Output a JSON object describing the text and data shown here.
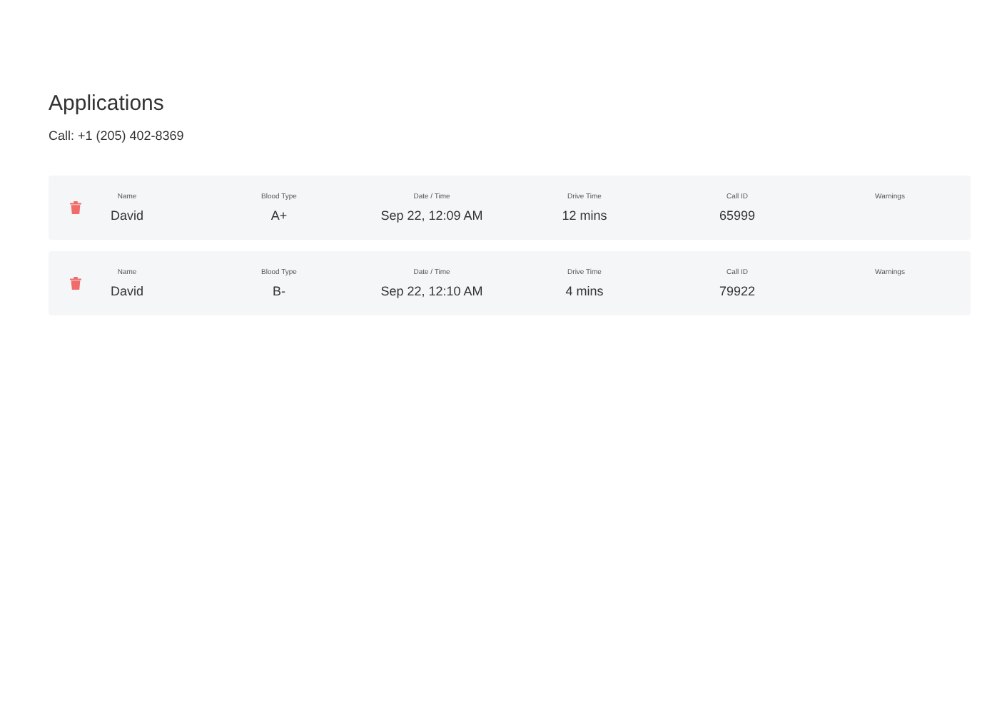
{
  "title": "Applications",
  "subtitle": "Call: +1 (205) 402-8369",
  "applications": [
    {
      "fields": [
        {
          "label": "Name",
          "value": "David"
        },
        {
          "label": "Blood Type",
          "value": "A+"
        },
        {
          "label": "Date / Time",
          "value": "Sep 22, 12:09 AM"
        },
        {
          "label": "Drive Time",
          "value": "12 mins"
        },
        {
          "label": "Call ID",
          "value": "65999"
        },
        {
          "label": "Warnings"
        }
      ]
    },
    {
      "fields": [
        {
          "label": "Name",
          "value": "David"
        },
        {
          "label": "Blood Type",
          "value": "B-"
        },
        {
          "label": "Date / Time",
          "value": "Sep 22, 12:10 AM"
        },
        {
          "label": "Drive Time",
          "value": "4 mins"
        },
        {
          "label": "Call ID",
          "value": "79922"
        },
        {
          "label": "Warnings"
        }
      ]
    }
  ]
}
